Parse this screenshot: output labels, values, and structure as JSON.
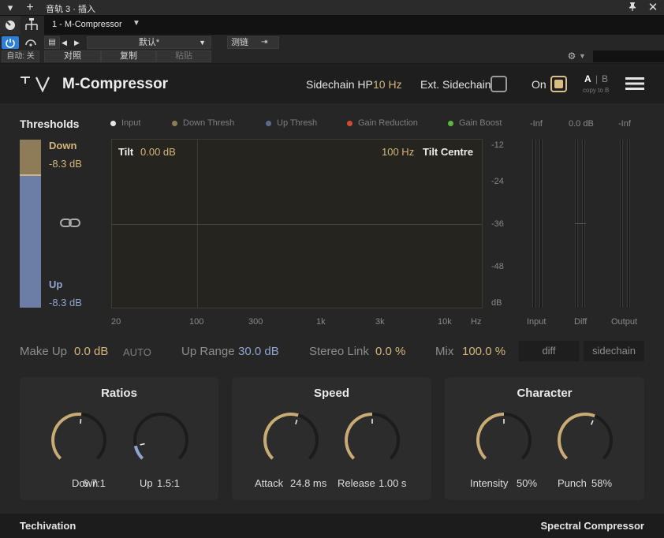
{
  "host": {
    "title": "音轨 3 · 插入",
    "preset_tab": "1 - M-Compressor",
    "preset_name": "默认*",
    "test_chain": "测链",
    "auto_label": "自动: 关",
    "compare_label": "对照",
    "copy_label": "复制",
    "paste_label": "粘贴"
  },
  "header": {
    "brand": "M-Compressor",
    "sidechain_hp_label": "Sidechain HP",
    "sidechain_hp_value": "10 Hz",
    "ext_sidechain_label": "Ext. Sidechain",
    "on_label": "On",
    "ab_a": "A",
    "ab_sep": "|",
    "ab_b": "B",
    "copy_to_b": "copy to B"
  },
  "thresholds": {
    "title": "Thresholds",
    "down_label": "Down",
    "down_value": "-8.3 dB",
    "up_label": "Up",
    "up_value": "-8.3 dB"
  },
  "legend": [
    {
      "label": "Input",
      "color": "#e6e6e6"
    },
    {
      "label": "Down Thresh",
      "color": "#8c7c58"
    },
    {
      "label": "Up Thresh",
      "color": "#5c6a8c"
    },
    {
      "label": "Gain Reduction",
      "color": "#d24a32"
    },
    {
      "label": "Gain Boost",
      "color": "#5cb83c"
    }
  ],
  "graph": {
    "tilt_label": "Tilt",
    "tilt_value": "0.00 dB",
    "centre_value": "100 Hz",
    "centre_label": "Tilt Centre",
    "db_ticks": [
      "-12",
      "-24",
      "-36",
      "-48",
      "dB"
    ],
    "freq_ticks": [
      "20",
      "100",
      "300",
      "1k",
      "3k",
      "10k",
      "Hz"
    ]
  },
  "meters": {
    "top_labels": [
      "-Inf",
      "0.0 dB",
      "-Inf"
    ],
    "bottom_labels": [
      "Input",
      "Diff",
      "Output"
    ]
  },
  "controls": {
    "makeup_label": "Make Up",
    "makeup_value": "0.0 dB",
    "auto_label": "AUTO",
    "up_range_label": "Up Range",
    "up_range_value": "30.0 dB",
    "stereo_link_label": "Stereo Link",
    "stereo_link_value": "0.0 %",
    "mix_label": "Mix",
    "mix_value": "100.0 %",
    "diff_button": "diff",
    "sidechain_button": "sidechain"
  },
  "ratios": {
    "title": "Ratios",
    "down_label": "Down",
    "down_value": "6.7:1",
    "down_level": 0.52,
    "up_label": "Up",
    "up_value": "1.5:1",
    "up_level": 0.12
  },
  "speed": {
    "title": "Speed",
    "attack_label": "Attack",
    "attack_value": "24.8 ms",
    "attack_level": 0.56,
    "release_label": "Release",
    "release_value": "1.00 s",
    "release_level": 0.5
  },
  "character": {
    "title": "Character",
    "intensity_label": "Intensity",
    "intensity_value": "50%",
    "intensity_level": 0.5,
    "punch_label": "Punch",
    "punch_value": "58%",
    "punch_level": 0.58
  },
  "footer": {
    "left": "Techivation",
    "right": "Spectral Compressor"
  },
  "colors": {
    "gold": "#d4b67a",
    "blue": "#8fa5cf",
    "knob_gold": "#c9ab74",
    "knob_blue": "#8fa5cf"
  }
}
